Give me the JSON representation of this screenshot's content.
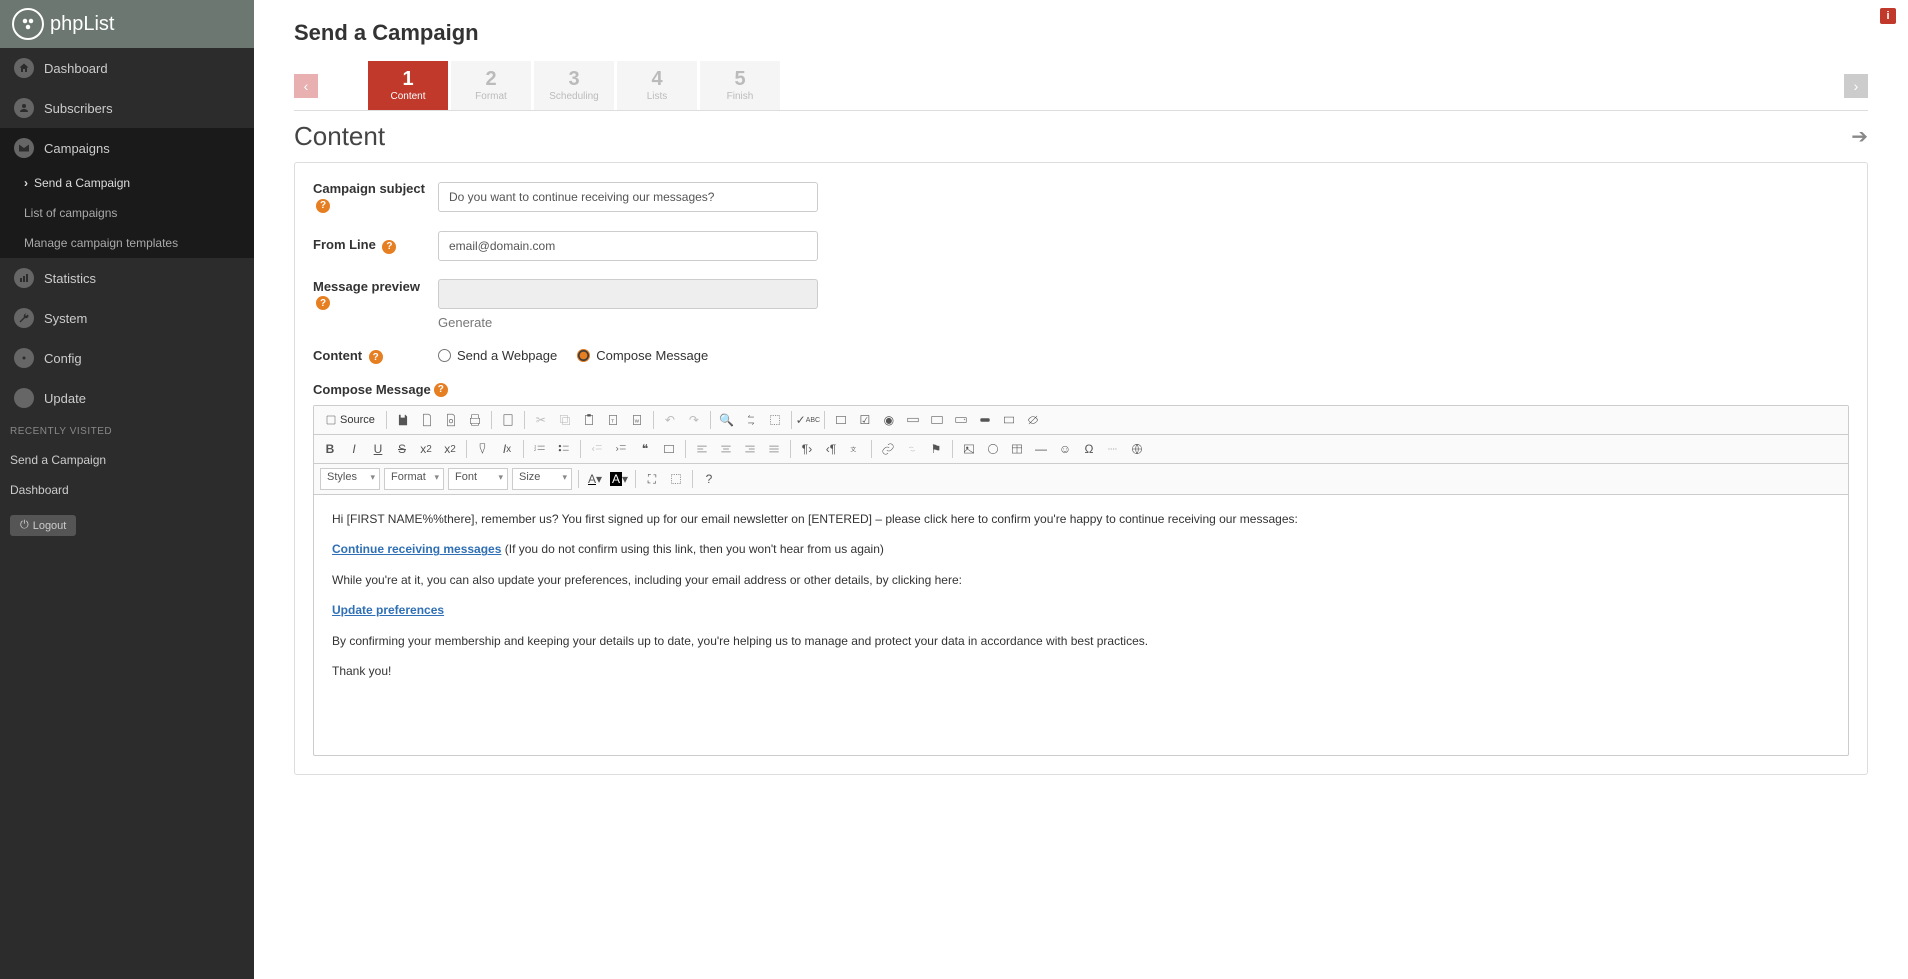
{
  "brand": "phpList",
  "nav": {
    "dashboard": "Dashboard",
    "subscribers": "Subscribers",
    "campaigns": "Campaigns",
    "campaigns_sub": {
      "send": "Send a Campaign",
      "list": "List of campaigns",
      "templates": "Manage campaign templates"
    },
    "statistics": "Statistics",
    "system": "System",
    "config": "Config",
    "update": "Update"
  },
  "recently_header": "RECENTLY VISITED",
  "recent": {
    "send": "Send a Campaign",
    "dashboard": "Dashboard"
  },
  "logout": "Logout",
  "page_title": "Send a Campaign",
  "steps": [
    {
      "num": "1",
      "label": "Content"
    },
    {
      "num": "2",
      "label": "Format"
    },
    {
      "num": "3",
      "label": "Scheduling"
    },
    {
      "num": "4",
      "label": "Lists"
    },
    {
      "num": "5",
      "label": "Finish"
    }
  ],
  "section_title": "Content",
  "form": {
    "subject_label": "Campaign subject",
    "subject_value": "Do you want to continue receiving our messages?",
    "from_label": "From Line",
    "from_value": "email@domain.com",
    "preview_label": "Message preview",
    "preview_value": "",
    "generate": "Generate",
    "content_label": "Content",
    "radio_webpage": "Send a Webpage",
    "radio_compose": "Compose Message",
    "compose_label": "Compose Message"
  },
  "toolbar": {
    "source": "Source",
    "styles": "Styles",
    "format": "Format",
    "font": "Font",
    "size": "Size"
  },
  "message": {
    "p1": "Hi [FIRST NAME%%there], remember us? You first signed up for our email newsletter on [ENTERED] – please click here to confirm you're happy to continue receiving our messages:",
    "link1": "Continue receiving messages",
    "note1": "  (If you do not confirm using this link, then you won't hear from us again)",
    "p2": "While you're at it, you can also update your preferences, including your email address or other details, by clicking here:",
    "link2": "Update preferences",
    "p3": "By confirming your membership and keeping your details up to date, you're helping us to manage and protect your data in accordance with best practices.",
    "p4": "Thank you!"
  }
}
